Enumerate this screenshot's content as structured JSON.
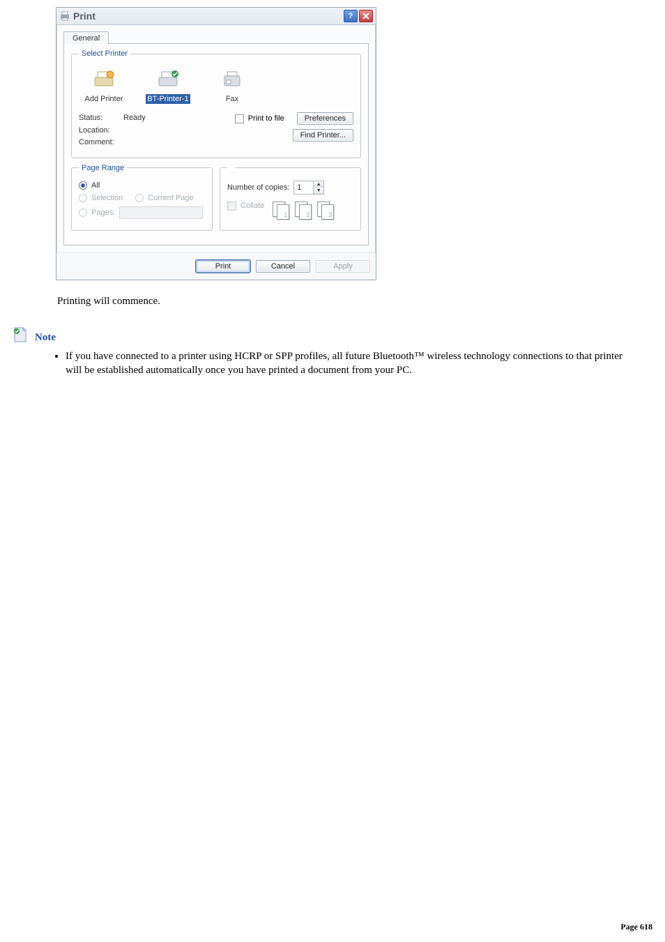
{
  "dialog": {
    "title": "Print",
    "tab": "General",
    "select_printer_legend": "Select Printer",
    "printers": [
      {
        "name": "add-printer",
        "label": "Add Printer",
        "selected": false
      },
      {
        "name": "bt-printer-1",
        "label": "BT-Printer-1",
        "selected": true
      },
      {
        "name": "fax",
        "label": "Fax",
        "selected": false
      }
    ],
    "status": {
      "status_label": "Status:",
      "status_value": "Ready",
      "location_label": "Location:",
      "location_value": "",
      "comment_label": "Comment:",
      "comment_value": ""
    },
    "print_to_file": "Print to file",
    "preferences_btn": "Preferences",
    "find_printer_btn": "Find Printer...",
    "page_range_legend": "Page Range",
    "range": {
      "all": "All",
      "selection": "Selection",
      "current_page": "Current Page",
      "pages": "Pages:"
    },
    "copies": {
      "label": "Number of copies:",
      "value": "1",
      "collate": "Collate"
    },
    "buttons": {
      "print": "Print",
      "cancel": "Cancel",
      "apply": "Apply"
    }
  },
  "body": {
    "line1": "Printing will commence.",
    "note_label": "Note",
    "note_bullet": "If you have connected to a printer using HCRP or SPP profiles, all future Bluetooth™ wireless technology connections to that printer will be established automatically once you have printed a document from your PC."
  },
  "footer": {
    "page_label": "Page 618"
  }
}
